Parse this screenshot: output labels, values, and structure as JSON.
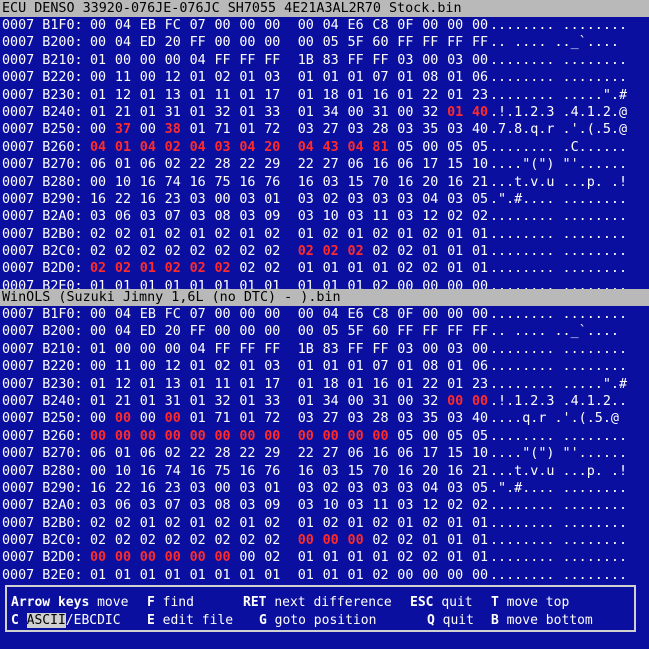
{
  "panes": [
    {
      "title": "ECU DENSO 33920-076JE-076JC SH7055 4E21A3AL2R70 Stock.bin",
      "rows": [
        {
          "addr": "0007 B1F0:",
          "hex": [
            "00",
            "04",
            "EB",
            "FC",
            "07",
            "00",
            "00",
            "00",
            "00",
            "04",
            "E6",
            "C8",
            "0F",
            "00",
            "00",
            "00"
          ],
          "ascii": "........ ........",
          "diff": []
        },
        {
          "addr": "0007 B200:",
          "hex": [
            "00",
            "04",
            "ED",
            "20",
            "FF",
            "00",
            "00",
            "00",
            "00",
            "05",
            "5F",
            "60",
            "FF",
            "FF",
            "FF",
            "FF"
          ],
          "ascii": ".. .... .._`....",
          "diff": []
        },
        {
          "addr": "0007 B210:",
          "hex": [
            "01",
            "00",
            "00",
            "00",
            "04",
            "FF",
            "FF",
            "FF",
            "1B",
            "83",
            "FF",
            "FF",
            "03",
            "00",
            "03",
            "00"
          ],
          "ascii": "........ ........",
          "diff": []
        },
        {
          "addr": "0007 B220:",
          "hex": [
            "00",
            "11",
            "00",
            "12",
            "01",
            "02",
            "01",
            "03",
            "01",
            "01",
            "01",
            "07",
            "01",
            "08",
            "01",
            "06"
          ],
          "ascii": "........ ........",
          "diff": []
        },
        {
          "addr": "0007 B230:",
          "hex": [
            "01",
            "12",
            "01",
            "13",
            "01",
            "11",
            "01",
            "17",
            "01",
            "18",
            "01",
            "16",
            "01",
            "22",
            "01",
            "23"
          ],
          "ascii": "........ .....\".#",
          "diff": []
        },
        {
          "addr": "0007 B240:",
          "hex": [
            "01",
            "21",
            "01",
            "31",
            "01",
            "32",
            "01",
            "33",
            "01",
            "34",
            "00",
            "31",
            "00",
            "32",
            "01",
            "40"
          ],
          "ascii": ".!.1.2.3 .4.1.2.@",
          "diff": [
            14,
            15
          ]
        },
        {
          "addr": "0007 B250:",
          "hex": [
            "00",
            "37",
            "00",
            "38",
            "01",
            "71",
            "01",
            "72",
            "03",
            "27",
            "03",
            "28",
            "03",
            "35",
            "03",
            "40"
          ],
          "ascii": ".7.8.q.r .'.(.5.@",
          "diff": [
            1,
            3
          ]
        },
        {
          "addr": "0007 B260:",
          "hex": [
            "04",
            "01",
            "04",
            "02",
            "04",
            "03",
            "04",
            "20",
            "04",
            "43",
            "04",
            "81",
            "05",
            "00",
            "05",
            "05"
          ],
          "ascii": "........ .C......",
          "diff": [
            0,
            1,
            2,
            3,
            4,
            5,
            6,
            7,
            8,
            9,
            10,
            11
          ]
        },
        {
          "addr": "0007 B270:",
          "hex": [
            "06",
            "01",
            "06",
            "02",
            "22",
            "28",
            "22",
            "29",
            "22",
            "27",
            "06",
            "16",
            "06",
            "17",
            "15",
            "10"
          ],
          "ascii": "....\"(\") \"'......",
          "diff": []
        },
        {
          "addr": "0007 B280:",
          "hex": [
            "00",
            "10",
            "16",
            "74",
            "16",
            "75",
            "16",
            "76",
            "16",
            "03",
            "15",
            "70",
            "16",
            "20",
            "16",
            "21"
          ],
          "ascii": "...t.v.u ...p. .!",
          "diff": []
        },
        {
          "addr": "0007 B290:",
          "hex": [
            "16",
            "22",
            "16",
            "23",
            "03",
            "00",
            "03",
            "01",
            "03",
            "02",
            "03",
            "03",
            "03",
            "04",
            "03",
            "05"
          ],
          "ascii": ".\".#.... ........",
          "diff": []
        },
        {
          "addr": "0007 B2A0:",
          "hex": [
            "03",
            "06",
            "03",
            "07",
            "03",
            "08",
            "03",
            "09",
            "03",
            "10",
            "03",
            "11",
            "03",
            "12",
            "02",
            "02"
          ],
          "ascii": "........ ........",
          "diff": []
        },
        {
          "addr": "0007 B2B0:",
          "hex": [
            "02",
            "02",
            "01",
            "02",
            "01",
            "02",
            "01",
            "02",
            "01",
            "02",
            "01",
            "02",
            "01",
            "02",
            "01",
            "01"
          ],
          "ascii": "........ ........",
          "diff": []
        },
        {
          "addr": "0007 B2C0:",
          "hex": [
            "02",
            "02",
            "02",
            "02",
            "02",
            "02",
            "02",
            "02",
            "02",
            "02",
            "02",
            "02",
            "02",
            "01",
            "01",
            "01"
          ],
          "ascii": "........ ........",
          "diff": [
            8,
            9,
            10
          ]
        },
        {
          "addr": "0007 B2D0:",
          "hex": [
            "02",
            "02",
            "01",
            "02",
            "02",
            "02",
            "02",
            "02",
            "01",
            "01",
            "01",
            "01",
            "02",
            "02",
            "01",
            "01"
          ],
          "ascii": "........ ........",
          "diff": [
            0,
            1,
            2,
            3,
            4,
            5
          ]
        },
        {
          "addr": "0007 B2E0:",
          "hex": [
            "01",
            "01",
            "01",
            "01",
            "01",
            "01",
            "01",
            "01",
            "01",
            "01",
            "01",
            "02",
            "00",
            "00",
            "00",
            "00"
          ],
          "ascii": "........ ........",
          "diff": []
        }
      ]
    },
    {
      "title": "WinOLS (Suzuki Jimny 1,6L (no DTC) - ).bin",
      "rows": [
        {
          "addr": "0007 B1F0:",
          "hex": [
            "00",
            "04",
            "EB",
            "FC",
            "07",
            "00",
            "00",
            "00",
            "00",
            "04",
            "E6",
            "C8",
            "0F",
            "00",
            "00",
            "00"
          ],
          "ascii": "........ ........",
          "diff": []
        },
        {
          "addr": "0007 B200:",
          "hex": [
            "00",
            "04",
            "ED",
            "20",
            "FF",
            "00",
            "00",
            "00",
            "00",
            "05",
            "5F",
            "60",
            "FF",
            "FF",
            "FF",
            "FF"
          ],
          "ascii": ".. .... .._`....",
          "diff": []
        },
        {
          "addr": "0007 B210:",
          "hex": [
            "01",
            "00",
            "00",
            "00",
            "04",
            "FF",
            "FF",
            "FF",
            "1B",
            "83",
            "FF",
            "FF",
            "03",
            "00",
            "03",
            "00"
          ],
          "ascii": "........ ........",
          "diff": []
        },
        {
          "addr": "0007 B220:",
          "hex": [
            "00",
            "11",
            "00",
            "12",
            "01",
            "02",
            "01",
            "03",
            "01",
            "01",
            "01",
            "07",
            "01",
            "08",
            "01",
            "06"
          ],
          "ascii": "........ ........",
          "diff": []
        },
        {
          "addr": "0007 B230:",
          "hex": [
            "01",
            "12",
            "01",
            "13",
            "01",
            "11",
            "01",
            "17",
            "01",
            "18",
            "01",
            "16",
            "01",
            "22",
            "01",
            "23"
          ],
          "ascii": "........ .....\".#",
          "diff": []
        },
        {
          "addr": "0007 B240:",
          "hex": [
            "01",
            "21",
            "01",
            "31",
            "01",
            "32",
            "01",
            "33",
            "01",
            "34",
            "00",
            "31",
            "00",
            "32",
            "00",
            "00"
          ],
          "ascii": ".!.1.2.3 .4.1.2..",
          "diff": [
            14,
            15
          ]
        },
        {
          "addr": "0007 B250:",
          "hex": [
            "00",
            "00",
            "00",
            "00",
            "01",
            "71",
            "01",
            "72",
            "03",
            "27",
            "03",
            "28",
            "03",
            "35",
            "03",
            "40"
          ],
          "ascii": "....q.r .'.(.5.@",
          "diff": [
            1,
            3
          ]
        },
        {
          "addr": "0007 B260:",
          "hex": [
            "00",
            "00",
            "00",
            "00",
            "00",
            "00",
            "00",
            "00",
            "00",
            "00",
            "00",
            "00",
            "05",
            "00",
            "05",
            "05"
          ],
          "ascii": "........ ........",
          "diff": [
            0,
            1,
            2,
            3,
            4,
            5,
            6,
            7,
            8,
            9,
            10,
            11
          ]
        },
        {
          "addr": "0007 B270:",
          "hex": [
            "06",
            "01",
            "06",
            "02",
            "22",
            "28",
            "22",
            "29",
            "22",
            "27",
            "06",
            "16",
            "06",
            "17",
            "15",
            "10"
          ],
          "ascii": "....\"(\") \"'......",
          "diff": []
        },
        {
          "addr": "0007 B280:",
          "hex": [
            "00",
            "10",
            "16",
            "74",
            "16",
            "75",
            "16",
            "76",
            "16",
            "03",
            "15",
            "70",
            "16",
            "20",
            "16",
            "21"
          ],
          "ascii": "...t.v.u ...p. .!",
          "diff": []
        },
        {
          "addr": "0007 B290:",
          "hex": [
            "16",
            "22",
            "16",
            "23",
            "03",
            "00",
            "03",
            "01",
            "03",
            "02",
            "03",
            "03",
            "03",
            "04",
            "03",
            "05"
          ],
          "ascii": ".\".#.... ........",
          "diff": []
        },
        {
          "addr": "0007 B2A0:",
          "hex": [
            "03",
            "06",
            "03",
            "07",
            "03",
            "08",
            "03",
            "09",
            "03",
            "10",
            "03",
            "11",
            "03",
            "12",
            "02",
            "02"
          ],
          "ascii": "........ ........",
          "diff": []
        },
        {
          "addr": "0007 B2B0:",
          "hex": [
            "02",
            "02",
            "01",
            "02",
            "01",
            "02",
            "01",
            "02",
            "01",
            "02",
            "01",
            "02",
            "01",
            "02",
            "01",
            "01"
          ],
          "ascii": "........ ........",
          "diff": []
        },
        {
          "addr": "0007 B2C0:",
          "hex": [
            "02",
            "02",
            "02",
            "02",
            "02",
            "02",
            "02",
            "02",
            "00",
            "00",
            "00",
            "02",
            "02",
            "01",
            "01",
            "01"
          ],
          "ascii": "........ ........",
          "diff": [
            8,
            9,
            10
          ]
        },
        {
          "addr": "0007 B2D0:",
          "hex": [
            "00",
            "00",
            "00",
            "00",
            "00",
            "00",
            "00",
            "02",
            "01",
            "01",
            "01",
            "01",
            "02",
            "02",
            "01",
            "01"
          ],
          "ascii": "........ ........",
          "diff": [
            0,
            1,
            2,
            3,
            4,
            5
          ]
        },
        {
          "addr": "0007 B2E0:",
          "hex": [
            "01",
            "01",
            "01",
            "01",
            "01",
            "01",
            "01",
            "01",
            "01",
            "01",
            "01",
            "02",
            "00",
            "00",
            "00",
            "00"
          ],
          "ascii": "........ ........",
          "diff": []
        }
      ]
    }
  ],
  "help": {
    "row1": [
      {
        "key": "Arrow keys",
        "label": "move"
      },
      {
        "key": "F",
        "label": "find"
      },
      {
        "key": "RET",
        "label": "next difference"
      },
      {
        "key": "ESC",
        "label": "quit"
      },
      {
        "key": "T",
        "label": "move top"
      }
    ],
    "row2": [
      {
        "key": "C",
        "label_selected": "ASCII",
        "label_rest": "/EBCDIC"
      },
      {
        "key": "E",
        "label": "edit file"
      },
      {
        "key": "G",
        "label": "goto position"
      },
      {
        "key": "Q",
        "label": "quit"
      },
      {
        "key": "B",
        "label": "move bottom"
      }
    ]
  },
  "colors": {
    "background": "#0a0fa0",
    "title_bar": "#b9b9b9",
    "diff": "#ff2b2b",
    "text": "#ffffff"
  }
}
